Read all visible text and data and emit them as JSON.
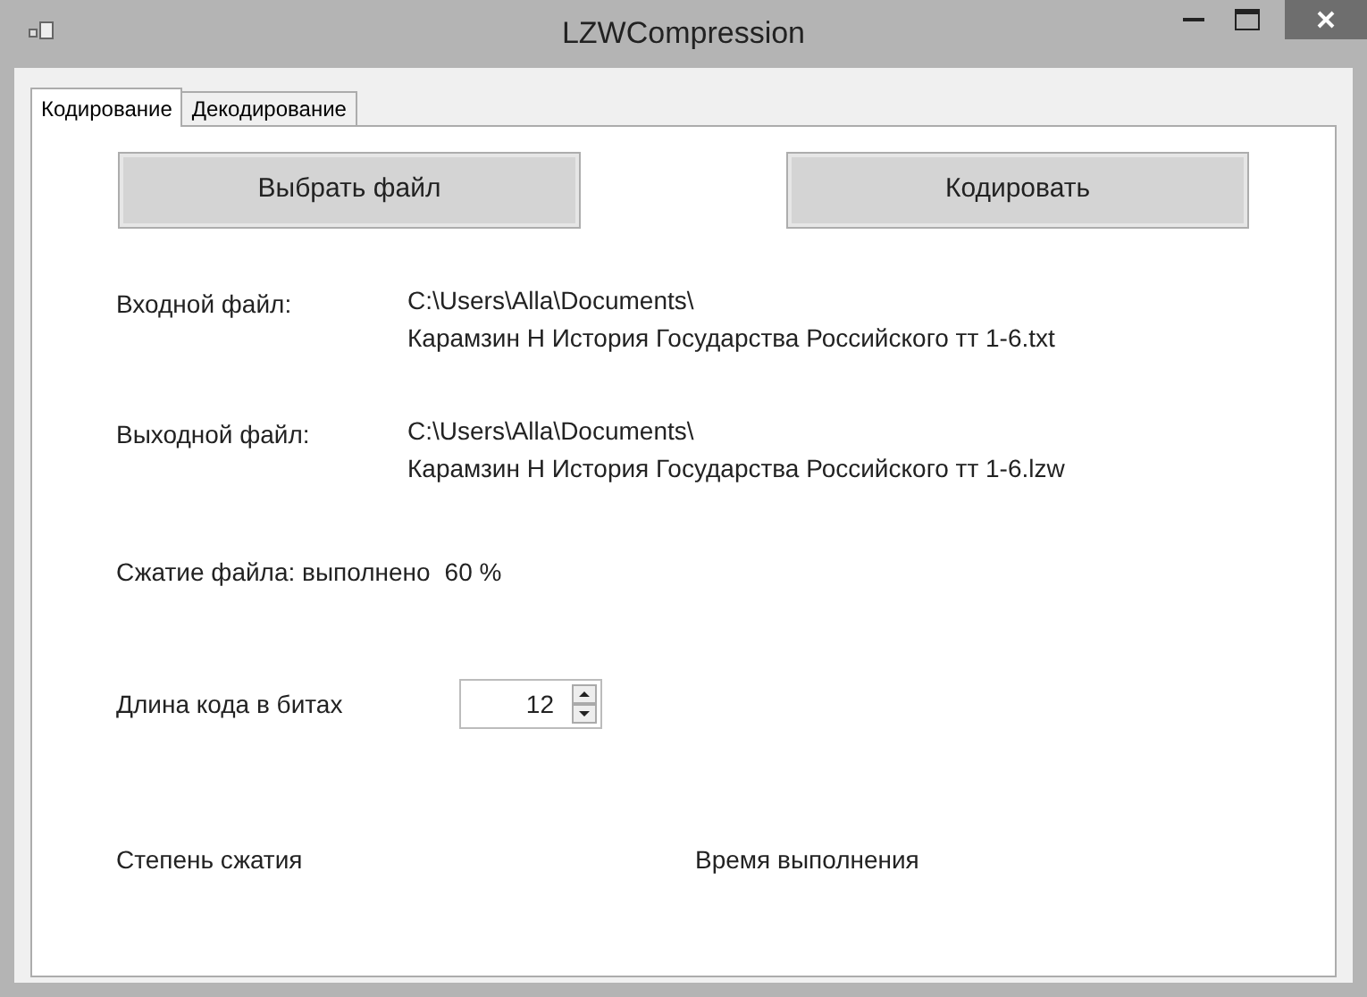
{
  "window": {
    "title": "LZWCompression"
  },
  "tabs": [
    {
      "label": "Кодирование",
      "selected": true
    },
    {
      "label": "Декодирование",
      "selected": false
    }
  ],
  "buttons": [
    "Выбрать файл",
    "Кодировать"
  ],
  "files": [
    {
      "label": "Входной файл:",
      "lines": [
        "C:\\Users\\Alla\\Documents\\",
        "Карамзин Н История Государства Российского тт 1-6.txt"
      ]
    },
    {
      "label": "Выходной файл:",
      "lines": [
        "C:\\Users\\Alla\\Documents\\",
        "Карамзин Н История Государства Российского тт 1-6.lzw"
      ]
    }
  ],
  "progress": {
    "label": "Сжатие файла: выполнено",
    "value": "60 %"
  },
  "code_length": {
    "label": "Длина кода в битах",
    "value": "12"
  },
  "results": [
    "Степень сжатия",
    "Время выполнения"
  ]
}
